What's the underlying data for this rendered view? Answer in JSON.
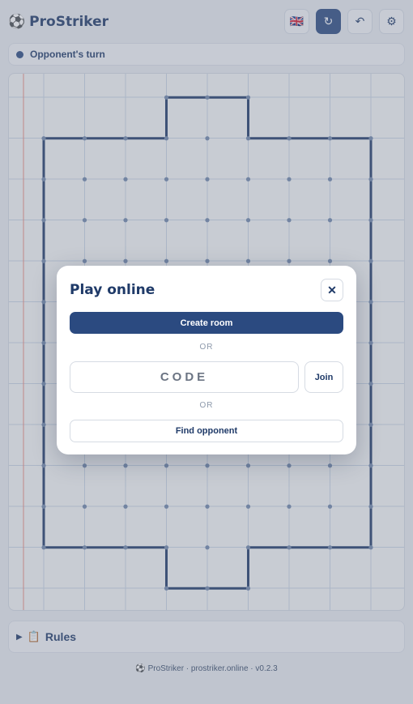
{
  "app": {
    "title": "ProStriker",
    "logo_icon": "⚽"
  },
  "header": {
    "language_flag": "🇬🇧",
    "restart_icon": "↻",
    "undo_icon": "↶",
    "settings_icon": "⚙"
  },
  "status": {
    "text": "Opponent's turn"
  },
  "colors": {
    "accent": "#2b4a80",
    "board_line": "#1f3a68",
    "grid": "#c7d3e2",
    "margin_line": "#e98a80",
    "dot": "#6f86aa"
  },
  "rules": {
    "arrow": "▶",
    "icon": "📋",
    "label": "Rules"
  },
  "footer": {
    "text": "⚽ ProStriker · prostriker.online · v0.2.3"
  },
  "modal": {
    "title": "Play online",
    "close_label": "✕",
    "create_room_label": "Create room",
    "or_label_1": "OR",
    "code_placeholder": "CODE",
    "code_value": "",
    "join_label": "Join",
    "or_label_2": "OR",
    "find_opponent_label": "Find opponent"
  }
}
